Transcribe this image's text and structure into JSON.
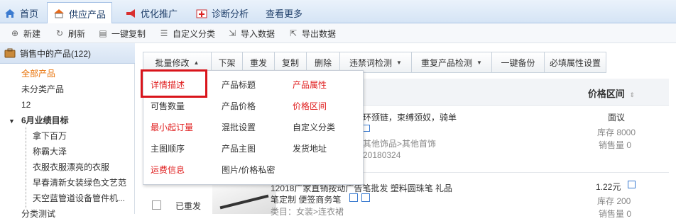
{
  "tabs": [
    {
      "label": "首页"
    },
    {
      "label": "供应产品"
    },
    {
      "label": "优化推广"
    },
    {
      "label": "诊断分析"
    },
    {
      "label": "查看更多"
    }
  ],
  "toolbar": {
    "new_label": "新建",
    "refresh_label": "刷新",
    "copy_label": "一键复制",
    "custom_cat_label": "自定义分类",
    "import_label": "导入数据",
    "export_label": "导出数据"
  },
  "sidebar": {
    "header": "销售中的产品(122)",
    "items": [
      {
        "label": "全部产品"
      },
      {
        "label": "未分类产品"
      },
      {
        "label": "12"
      },
      {
        "label": "6月业绩目标"
      },
      {
        "label": "拿下百万"
      },
      {
        "label": "称霸大泽"
      },
      {
        "label": "衣服衣服漂亮的衣服"
      },
      {
        "label": "早春清新女装绿色文艺范"
      },
      {
        "label": "天空蓝管道设备管件机..."
      },
      {
        "label": "分类测试"
      }
    ]
  },
  "actions": {
    "batch_edit": "批量修改",
    "remove": "下架",
    "republish": "重发",
    "copy": "复制",
    "delete": "删除",
    "forbidden_check": "违禁词检测",
    "duplicate_check": "重复产品检测",
    "backup": "一键备份",
    "required_attr": "必填属性设置"
  },
  "table": {
    "price_header": "价格区间"
  },
  "dropdown": {
    "items": [
      {
        "label": "详情描述"
      },
      {
        "label": "产品标题"
      },
      {
        "label": "产品属性"
      },
      {
        "label": "可售数量"
      },
      {
        "label": "产品价格"
      },
      {
        "label": "价格区间"
      },
      {
        "label": "最小起订量"
      },
      {
        "label": "混批设置"
      },
      {
        "label": "自定义分类"
      },
      {
        "label": "主图顺序"
      },
      {
        "label": "产品主图"
      },
      {
        "label": "发货地址"
      },
      {
        "label": "运费信息"
      },
      {
        "label": "图片/价格私密"
      }
    ]
  },
  "rows": [
    {
      "title_tail": "环颈链，束缚颈奴，骑单",
      "cat_tail": "其他饰品>其他首饰",
      "code_tail": "20180324",
      "price": "面议",
      "stock": "库存 8000",
      "sales": "销售量 0"
    },
    {
      "title_tail": "12018广家直销按动广告笔批发 塑料圆珠笔 礼品",
      "title2": "笔定制 便签商务笔",
      "cat": "类目：女装>连衣裙",
      "status": "已重发",
      "price": "1.22元",
      "stock": "库存 200",
      "sales": "销售量 0"
    }
  ],
  "colors": {
    "accent_red": "#e02020",
    "highlight": "#d9141b",
    "link_orange": "#e8730a"
  }
}
